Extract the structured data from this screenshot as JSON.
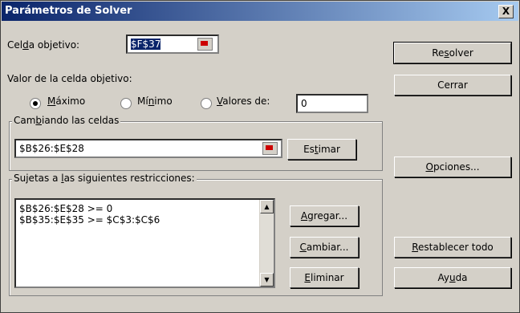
{
  "title": "Parámetros de Solver",
  "close_label": "X",
  "target": {
    "label_pre": "Cel",
    "label_key": "d",
    "label_post": "a objetivo:",
    "value": "$F$37"
  },
  "valor": {
    "label": "Valor de la celda objetivo:"
  },
  "options": {
    "max": {
      "key": "M",
      "rest": "áximo",
      "selected": true
    },
    "min": {
      "pre": "Mí",
      "key": "n",
      "rest": "imo",
      "selected": false
    },
    "val": {
      "key": "V",
      "rest": "alores de:",
      "selected": false,
      "value": "0"
    }
  },
  "changing": {
    "legend_pre": "Cam",
    "legend_key": "b",
    "legend_post": "iando las celdas",
    "value": "$B$26:$E$28",
    "estimate_pre": "Es",
    "estimate_key": "t",
    "estimate_post": "imar"
  },
  "constraints": {
    "legend_pre": "Sujetas a ",
    "legend_key": "l",
    "legend_post": "as siguientes restricciones:",
    "items": [
      "$B$26:$E$28 >= 0",
      "$B$35:$E$35 >= $C$3:$C$6"
    ],
    "scroll_up": "▲",
    "scroll_down": "▼",
    "add": {
      "key": "A",
      "rest": "gregar..."
    },
    "change": {
      "key": "C",
      "rest": "ambiar..."
    },
    "delete": {
      "key": "E",
      "rest": "liminar"
    }
  },
  "buttons": {
    "solve": {
      "pre": "Re",
      "key": "s",
      "rest": "olver"
    },
    "close": "Cerrar",
    "options": {
      "key": "O",
      "rest": "pciones..."
    },
    "reset": {
      "key": "R",
      "rest": "establecer todo"
    },
    "help": {
      "pre": "Ay",
      "key": "u",
      "rest": "da"
    }
  }
}
